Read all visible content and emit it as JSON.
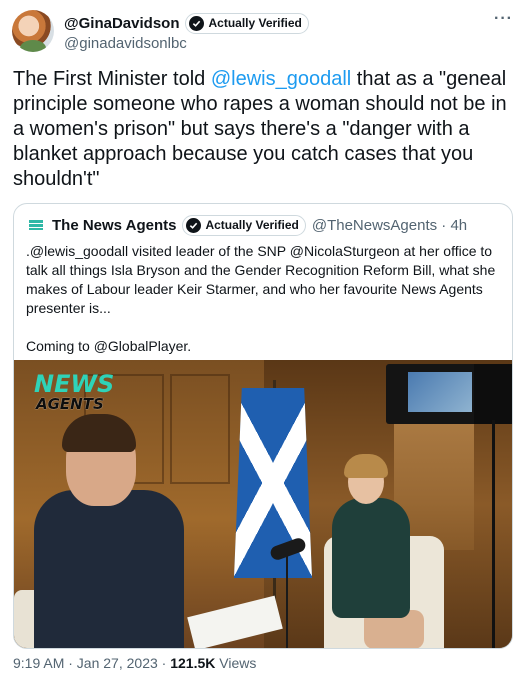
{
  "tweet": {
    "author": {
      "display_name": "@GinaDavidson",
      "handle": "@ginadavidsonlbc",
      "badge_label": "Actually Verified"
    },
    "more_icon": "more-horizontal-icon",
    "text": {
      "before": "The First Minister told ",
      "mention": "@lewis_goodall",
      "after": " that as a \"geneal principle someone who rapes a woman should not be in a women's prison\" but says there's a \"danger with a blanket approach because you catch cases that you shouldn't\""
    },
    "quoted": {
      "display_name": "The News Agents",
      "badge_label": "Actually Verified",
      "handle_time": "@TheNewsAgents · 4h",
      "paragraph_1": ".@lewis_goodall visited leader of the SNP @NicolaSturgeon at her office to talk all things Isla Bryson and the Gender Recognition Reform Bill, what she makes of Labour leader Keir Starmer, and who her favourite News Agents presenter is...",
      "paragraph_2": "Coming to @GlobalPlayer.",
      "image": {
        "logo_line_1": "NEWS",
        "logo_line_2": "AGENTS"
      }
    },
    "meta": {
      "time_date": "9:19 AM · Jan 27, 2023 · ",
      "views_count": "121.5K",
      "views_label": " Views"
    }
  },
  "colors": {
    "link": "#1d9bf0",
    "secondary_text": "#536471",
    "primary_text": "#0f1419",
    "logo_accent": "#2fd3b8"
  }
}
